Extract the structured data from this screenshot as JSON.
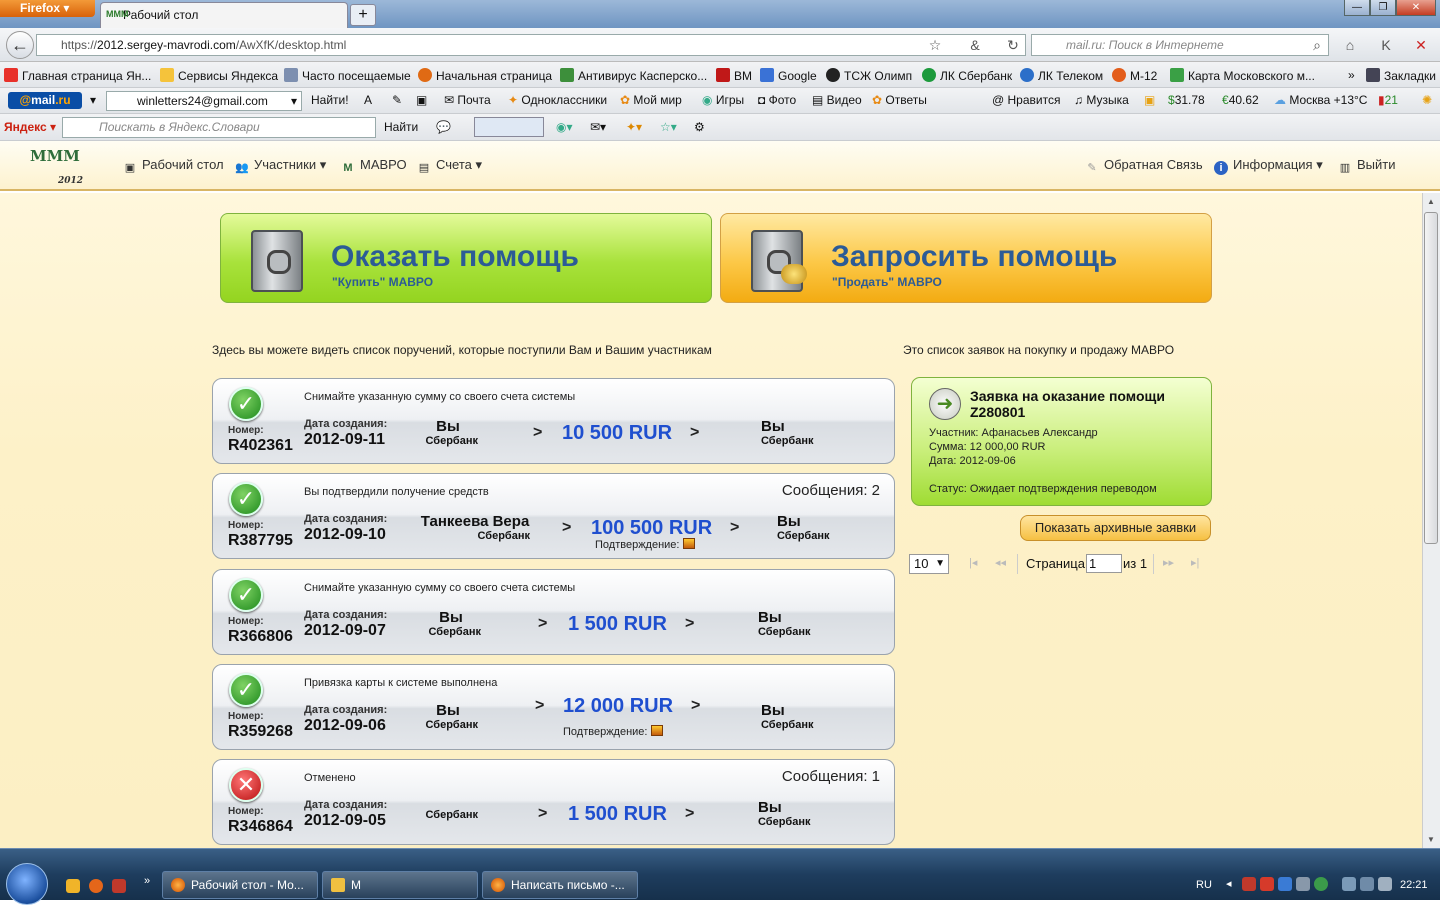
{
  "browser": {
    "app_button": "Firefox",
    "tab_title": "Рабочий стол",
    "new_tab": "+",
    "url_prefix": "https://",
    "url_host": "2012.sergey-mavrodi.com",
    "url_path": "/AwXfK/desktop.html",
    "search_placeholder": "mail.ru: Поиск в Интернете"
  },
  "bookmarks": [
    {
      "label": "Главная страница Ян...",
      "color": "#e8312a"
    },
    {
      "label": "Сервисы Яндекса",
      "color": "#f5c33b"
    },
    {
      "label": "Часто посещаемые",
      "color": "#7d8fb0"
    },
    {
      "label": "Начальная страница",
      "color": "#e06a14"
    },
    {
      "label": "Антивирус Касперско...",
      "color": "#3d8f3b"
    },
    {
      "label": "ВМ",
      "color": "#c01818"
    },
    {
      "label": "Google",
      "color": "#3a72d6"
    },
    {
      "label": "ТСЖ Олимп",
      "color": "#222222"
    },
    {
      "label": "ЛК Сбербанк",
      "color": "#1c9a3c"
    },
    {
      "label": "ЛК Телеком",
      "color": "#2c6fc9"
    },
    {
      "label": "М-12",
      "color": "#e35d1b"
    },
    {
      "label": "Карта Московского м...",
      "color": "#3aa045"
    }
  ],
  "bookmarks_more": "»",
  "bookmarks_folder": "Закладки",
  "mailbar": {
    "logo_at": "@",
    "logo_text": "mail",
    "logo_ru": ".ru",
    "email": "winletters24@gmail.com",
    "find": "Найти!",
    "items": [
      "Почта",
      "Одноклассники",
      "Мой мир",
      "Игры",
      "Фото",
      "Видео",
      "Ответы"
    ],
    "right_items": [
      "Нравится",
      "Музыка"
    ],
    "usd": "31.78",
    "eur": "40.62",
    "weather": "Москва +13°C",
    "traffic": "21"
  },
  "yandexbar": {
    "logo": "Яндекс",
    "placeholder": "Поискать в Яндекс.Словари",
    "find": "Найти"
  },
  "site": {
    "logo": "MMM",
    "logo_year": "2012",
    "menu": [
      {
        "label": "Рабочий стол",
        "icon": "desktop-icon"
      },
      {
        "label": "Участники ▾",
        "icon": "users-icon"
      },
      {
        "label": "МАВРО",
        "icon": "mavro-icon"
      },
      {
        "label": "Счета ▾",
        "icon": "accounts-icon"
      }
    ],
    "menu_right": [
      {
        "label": "Обратная Связь",
        "icon": "pencil-icon"
      },
      {
        "label": "Информация ▾",
        "icon": "info-icon"
      },
      {
        "label": "Выйти",
        "icon": "exit-icon"
      }
    ]
  },
  "actions": {
    "give_title": "Оказать помощь",
    "give_sub": "\"Купить\" МАВРО",
    "ask_title": "Запросить помощь",
    "ask_sub": "\"Продать\" МАВРО"
  },
  "orders_intro": "Здесь вы можете видеть список поручений, которые поступили Вам и Вашим участникам",
  "requests_intro": "Это список заявок на покупку и продажу МАВРО",
  "order_labels": {
    "number": "Номер:",
    "created": "Дата создания:",
    "confirm": "Подтверждение:",
    "arrow": ">"
  },
  "orders": [
    {
      "status": "ok",
      "desc": "Снимайте указанную сумму со своего счета системы",
      "messages": "",
      "number": "R402361",
      "date": "2012-09-11",
      "from_name": "Вы",
      "from_bank": "Сбербанк",
      "amount": "10 500 RUR",
      "confirm": false,
      "to_name": "Вы",
      "to_bank": "Сбербанк"
    },
    {
      "status": "ok",
      "desc": "Вы подтвердили получение средств",
      "messages": "Сообщения: 2",
      "number": "R387795",
      "date": "2012-09-10",
      "from_name": "Танкеева Вера",
      "from_bank": "Сбербанк",
      "amount": "100 500 RUR",
      "confirm": true,
      "to_name": "Вы",
      "to_bank": "Сбербанк"
    },
    {
      "status": "ok",
      "desc": "Снимайте указанную сумму со своего счета системы",
      "messages": "",
      "number": "R366806",
      "date": "2012-09-07",
      "from_name": "Вы",
      "from_bank": "Сбербанк",
      "amount": "1 500 RUR",
      "confirm": false,
      "to_name": "Вы",
      "to_bank": "Сбербанк"
    },
    {
      "status": "ok",
      "desc": "Привязка карты к системе выполнена",
      "messages": "",
      "number": "R359268",
      "date": "2012-09-06",
      "from_name": "Вы",
      "from_bank": "Сбербанк",
      "amount": "12 000 RUR",
      "confirm": true,
      "to_name": "Вы",
      "to_bank": "Сбербанк"
    },
    {
      "status": "cancel",
      "desc": "Отменено",
      "messages": "Сообщения: 1",
      "number": "R346864",
      "date": "2012-09-05",
      "from_name": "",
      "from_bank": "Сбербанк",
      "amount": "1 500 RUR",
      "confirm": false,
      "to_name": "Вы",
      "to_bank": "Сбербанк"
    }
  ],
  "request": {
    "title": "Заявка на оказание помощи",
    "id": "Z280801",
    "participant": "Участник: Афанасьев Александр",
    "sum": "Сумма: 12 000,00 RUR",
    "date": "Дата: 2012-09-06",
    "status": "Статус: Ожидает подтверждения переводом"
  },
  "archive_button": "Показать архивные заявки",
  "pager": {
    "per_page": "10",
    "page_label": "Страница",
    "page": "1",
    "of": "из 1"
  },
  "taskbar": {
    "windows": [
      "Рабочий стол - Мо...",
      "М",
      "Написать письмо -..."
    ],
    "lang": "RU",
    "time": "22:21"
  }
}
